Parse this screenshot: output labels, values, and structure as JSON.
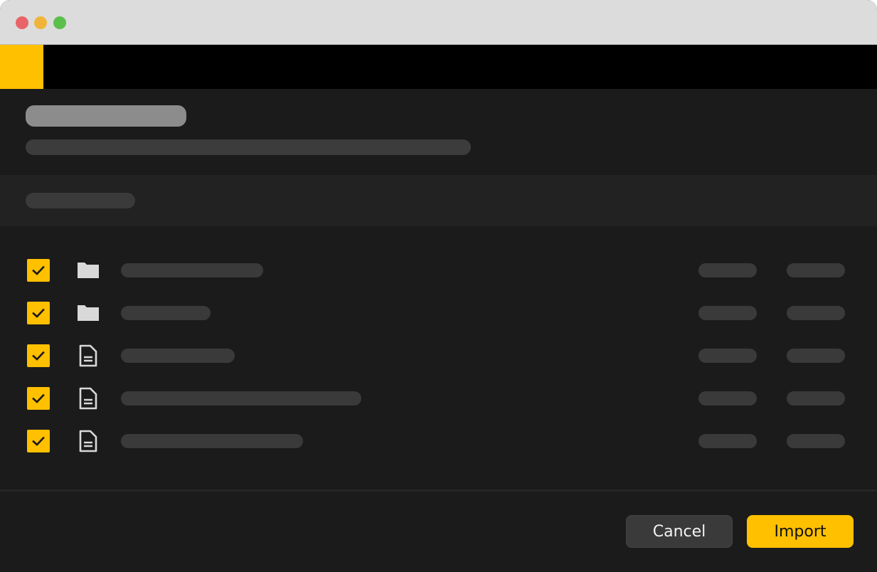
{
  "window": {
    "traffic_lights": {
      "close": "#e96467",
      "minimize": "#f0b43a",
      "zoom": "#5bbf4c"
    }
  },
  "colors": {
    "accent": "#ffc000",
    "checkmark": "#1a1a1a",
    "icon": "#d9d9d9"
  },
  "items": [
    {
      "type": "folder",
      "icon": "folder-icon",
      "checked": true
    },
    {
      "type": "folder",
      "icon": "folder-icon",
      "checked": true
    },
    {
      "type": "file",
      "icon": "document-icon",
      "checked": true
    },
    {
      "type": "file",
      "icon": "document-icon",
      "checked": true
    },
    {
      "type": "file",
      "icon": "document-icon",
      "checked": true
    }
  ],
  "footer": {
    "cancel_label": "Cancel",
    "import_label": "Import"
  }
}
